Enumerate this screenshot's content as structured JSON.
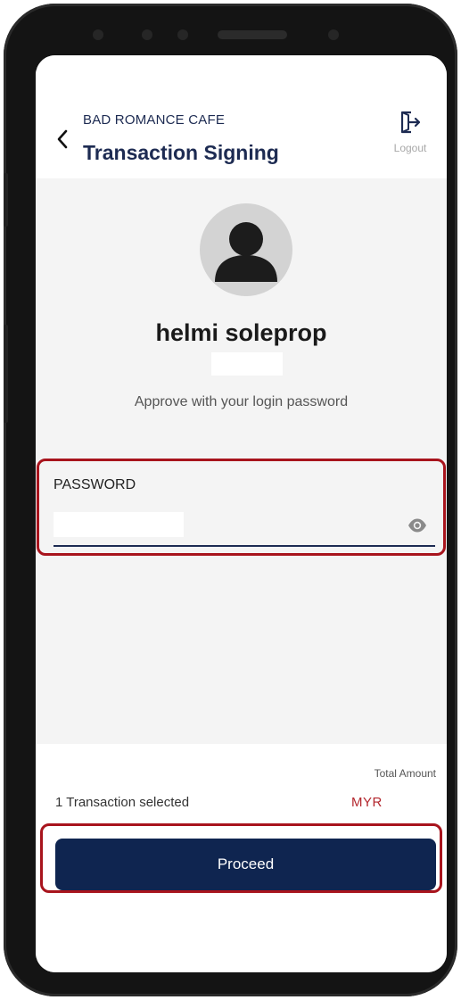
{
  "header": {
    "merchant_name": "BAD ROMANCE CAFE",
    "title": "Transaction Signing",
    "back_icon": "chevron-left-icon",
    "logout_label": "Logout",
    "logout_icon": "logout-icon"
  },
  "profile": {
    "avatar_icon": "user-avatar-icon",
    "name": "helmi soleprop",
    "instruction": "Approve with your login password"
  },
  "password": {
    "label": "PASSWORD",
    "value": "",
    "visibility_icon": "eye-icon"
  },
  "summary": {
    "total_label": "Total Amount",
    "selected_text": "1 Transaction selected",
    "currency": "MYR"
  },
  "actions": {
    "proceed_label": "Proceed"
  },
  "colors": {
    "primary": "#0f2550",
    "title_text": "#1d2b52",
    "accent_red": "#b3262d",
    "highlight": "#a8141d"
  }
}
